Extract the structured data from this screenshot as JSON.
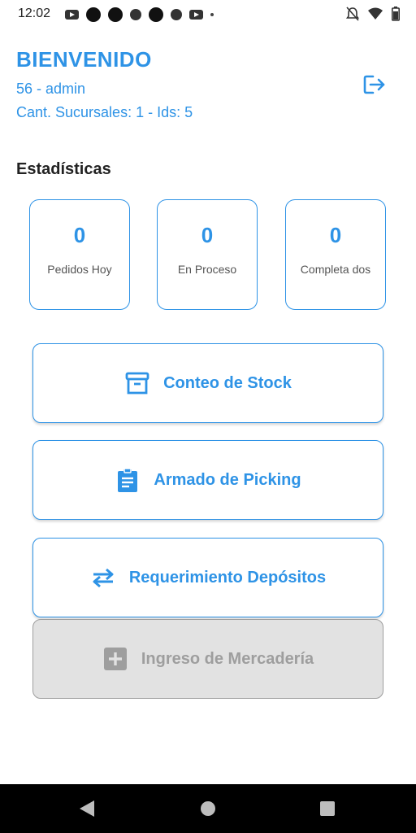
{
  "status_bar": {
    "time": "12:02",
    "icons_left": [
      "youtube-icon",
      "notification-dot",
      "notification-dot",
      "app-icon",
      "notification-dot",
      "app-icon",
      "youtube-icon",
      "more-dot"
    ],
    "icons_right": [
      "alarm-off-icon",
      "wifi-icon",
      "battery-icon"
    ]
  },
  "header": {
    "title": "BIENVENIDO",
    "user": "56 - admin",
    "branches": "Cant. Sucursales: 1 - Ids: 5",
    "logout_icon": "logout-icon"
  },
  "stats": {
    "title": "Estadísticas",
    "cards": [
      {
        "value": "0",
        "label": "Pedidos Hoy"
      },
      {
        "value": "0",
        "label": "En Proceso"
      },
      {
        "value": "0",
        "label": "Completa dos"
      }
    ]
  },
  "actions": [
    {
      "label": "Conteo de Stock",
      "icon": "archive-box-icon",
      "enabled": true
    },
    {
      "label": "Armado de Picking",
      "icon": "clipboard-icon",
      "enabled": true
    },
    {
      "label": "Requerimiento Depósitos",
      "icon": "swap-arrows-icon",
      "enabled": true
    },
    {
      "label": "Ingreso de Mercadería",
      "icon": "add-box-icon",
      "enabled": false
    }
  ],
  "colors": {
    "accent": "#2e93e6",
    "disabled_bg": "#e2e2e2",
    "disabled_text": "#9e9e9e",
    "nav_bar": "#000000"
  },
  "nav_bar": {
    "buttons": [
      "back-icon",
      "home-icon",
      "recents-icon"
    ]
  }
}
